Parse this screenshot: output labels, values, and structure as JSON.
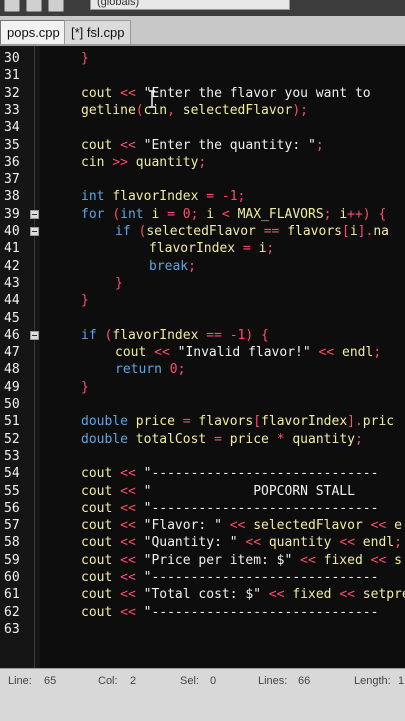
{
  "toolbar": {
    "scope_text": "(globals)"
  },
  "tabs": [
    {
      "label": "pops.cpp"
    },
    {
      "label": "[*] fsl.cpp"
    }
  ],
  "code_lines": [
    {
      "num": "30",
      "fold": false,
      "indent": 0,
      "tokens": [
        [
          "op",
          "}"
        ]
      ]
    },
    {
      "num": "31",
      "fold": false,
      "indent": 0,
      "tokens": []
    },
    {
      "num": "32",
      "fold": false,
      "indent": 0,
      "tokens": [
        [
          "id",
          "cout "
        ],
        [
          "op",
          "<< "
        ],
        [
          "str",
          "\"Enter the flavor you want to"
        ]
      ]
    },
    {
      "num": "33",
      "fold": false,
      "indent": 0,
      "tokens": [
        [
          "id",
          "getline"
        ],
        [
          "op",
          "("
        ],
        [
          "id",
          "cin"
        ],
        [
          "op",
          ", "
        ],
        [
          "id",
          "selectedFlavor"
        ],
        [
          "op",
          ");"
        ]
      ]
    },
    {
      "num": "34",
      "fold": false,
      "indent": 0,
      "tokens": []
    },
    {
      "num": "35",
      "fold": false,
      "indent": 0,
      "tokens": [
        [
          "id",
          "cout "
        ],
        [
          "op",
          "<< "
        ],
        [
          "str",
          "\"Enter the quantity: \""
        ],
        [
          "op",
          ";"
        ]
      ]
    },
    {
      "num": "36",
      "fold": false,
      "indent": 0,
      "tokens": [
        [
          "id",
          "cin "
        ],
        [
          "op",
          ">> "
        ],
        [
          "id",
          "quantity"
        ],
        [
          "op",
          ";"
        ]
      ]
    },
    {
      "num": "37",
      "fold": false,
      "indent": 0,
      "tokens": []
    },
    {
      "num": "38",
      "fold": false,
      "indent": 0,
      "tokens": [
        [
          "kw",
          "int "
        ],
        [
          "id",
          "flavorIndex "
        ],
        [
          "op",
          "= -"
        ],
        [
          "num",
          "1"
        ],
        [
          "op",
          ";"
        ]
      ]
    },
    {
      "num": "39",
      "fold": true,
      "indent": 0,
      "tokens": [
        [
          "kw",
          "for "
        ],
        [
          "op",
          "("
        ],
        [
          "kw",
          "int "
        ],
        [
          "id",
          "i "
        ],
        [
          "op",
          "= "
        ],
        [
          "num",
          "0"
        ],
        [
          "op",
          "; "
        ],
        [
          "id",
          "i "
        ],
        [
          "op",
          "< "
        ],
        [
          "id",
          "MAX_FLAVORS"
        ],
        [
          "op",
          "; "
        ],
        [
          "id",
          "i"
        ],
        [
          "op",
          "++) {"
        ]
      ]
    },
    {
      "num": "40",
      "fold": true,
      "indent": 1,
      "tokens": [
        [
          "kw",
          "if "
        ],
        [
          "op",
          "("
        ],
        [
          "id",
          "selectedFlavor "
        ],
        [
          "op",
          "== "
        ],
        [
          "id",
          "flavors"
        ],
        [
          "op",
          "["
        ],
        [
          "id",
          "i"
        ],
        [
          "op",
          "]."
        ],
        [
          "id",
          "na"
        ]
      ]
    },
    {
      "num": "41",
      "fold": false,
      "indent": 2,
      "tokens": [
        [
          "id",
          "flavorIndex "
        ],
        [
          "op",
          "= "
        ],
        [
          "id",
          "i"
        ],
        [
          "op",
          ";"
        ]
      ]
    },
    {
      "num": "42",
      "fold": false,
      "indent": 2,
      "tokens": [
        [
          "kw",
          "break"
        ],
        [
          "op",
          ";"
        ]
      ]
    },
    {
      "num": "43",
      "fold": false,
      "indent": 1,
      "tokens": [
        [
          "op",
          "}"
        ]
      ]
    },
    {
      "num": "44",
      "fold": false,
      "indent": 0,
      "tokens": [
        [
          "op",
          "}"
        ]
      ]
    },
    {
      "num": "45",
      "fold": false,
      "indent": 0,
      "tokens": []
    },
    {
      "num": "46",
      "fold": true,
      "indent": 0,
      "tokens": [
        [
          "kw",
          "if "
        ],
        [
          "op",
          "("
        ],
        [
          "id",
          "flavorIndex "
        ],
        [
          "op",
          "== -"
        ],
        [
          "num",
          "1"
        ],
        [
          "op",
          ") {"
        ]
      ]
    },
    {
      "num": "47",
      "fold": false,
      "indent": 1,
      "tokens": [
        [
          "id",
          "cout "
        ],
        [
          "op",
          "<< "
        ],
        [
          "str",
          "\"Invalid flavor!\" "
        ],
        [
          "op",
          "<< "
        ],
        [
          "id",
          "endl"
        ],
        [
          "op",
          ";"
        ]
      ]
    },
    {
      "num": "48",
      "fold": false,
      "indent": 1,
      "tokens": [
        [
          "kw",
          "return "
        ],
        [
          "num",
          "0"
        ],
        [
          "op",
          ";"
        ]
      ]
    },
    {
      "num": "49",
      "fold": false,
      "indent": 0,
      "tokens": [
        [
          "op",
          "}"
        ]
      ]
    },
    {
      "num": "50",
      "fold": false,
      "indent": 0,
      "tokens": []
    },
    {
      "num": "51",
      "fold": false,
      "indent": 0,
      "tokens": [
        [
          "kw",
          "double "
        ],
        [
          "id",
          "price "
        ],
        [
          "op",
          "= "
        ],
        [
          "id",
          "flavors"
        ],
        [
          "op",
          "["
        ],
        [
          "id",
          "flavorIndex"
        ],
        [
          "op",
          "]."
        ],
        [
          "id",
          "pric"
        ]
      ]
    },
    {
      "num": "52",
      "fold": false,
      "indent": 0,
      "tokens": [
        [
          "kw",
          "double "
        ],
        [
          "id",
          "totalCost "
        ],
        [
          "op",
          "= "
        ],
        [
          "id",
          "price "
        ],
        [
          "op",
          "* "
        ],
        [
          "id",
          "quantity"
        ],
        [
          "op",
          ";"
        ]
      ]
    },
    {
      "num": "53",
      "fold": false,
      "indent": 0,
      "tokens": []
    },
    {
      "num": "54",
      "fold": false,
      "indent": 0,
      "tokens": [
        [
          "id",
          "cout "
        ],
        [
          "op",
          "<< "
        ],
        [
          "str",
          "\"-----------------------------"
        ]
      ]
    },
    {
      "num": "55",
      "fold": false,
      "indent": 0,
      "tokens": [
        [
          "id",
          "cout "
        ],
        [
          "op",
          "<< "
        ],
        [
          "str",
          "\"             POPCORN STALL"
        ]
      ]
    },
    {
      "num": "56",
      "fold": false,
      "indent": 0,
      "tokens": [
        [
          "id",
          "cout "
        ],
        [
          "op",
          "<< "
        ],
        [
          "str",
          "\"-----------------------------"
        ]
      ]
    },
    {
      "num": "57",
      "fold": false,
      "indent": 0,
      "tokens": [
        [
          "id",
          "cout "
        ],
        [
          "op",
          "<< "
        ],
        [
          "str",
          "\"Flavor: \" "
        ],
        [
          "op",
          "<< "
        ],
        [
          "id",
          "selectedFlavor "
        ],
        [
          "op",
          "<< "
        ],
        [
          "id",
          "e"
        ]
      ]
    },
    {
      "num": "58",
      "fold": false,
      "indent": 0,
      "tokens": [
        [
          "id",
          "cout "
        ],
        [
          "op",
          "<< "
        ],
        [
          "str",
          "\"Quantity: \" "
        ],
        [
          "op",
          "<< "
        ],
        [
          "id",
          "quantity "
        ],
        [
          "op",
          "<< "
        ],
        [
          "id",
          "endl"
        ],
        [
          "op",
          ";"
        ]
      ]
    },
    {
      "num": "59",
      "fold": false,
      "indent": 0,
      "tokens": [
        [
          "id",
          "cout "
        ],
        [
          "op",
          "<< "
        ],
        [
          "str",
          "\"Price per item: $\" "
        ],
        [
          "op",
          "<< "
        ],
        [
          "id",
          "fixed "
        ],
        [
          "op",
          "<< "
        ],
        [
          "id",
          "s"
        ]
      ]
    },
    {
      "num": "60",
      "fold": false,
      "indent": 0,
      "tokens": [
        [
          "id",
          "cout "
        ],
        [
          "op",
          "<< "
        ],
        [
          "str",
          "\"-----------------------------"
        ]
      ]
    },
    {
      "num": "61",
      "fold": false,
      "indent": 0,
      "tokens": [
        [
          "id",
          "cout "
        ],
        [
          "op",
          "<< "
        ],
        [
          "str",
          "\"Total cost: $\" "
        ],
        [
          "op",
          "<< "
        ],
        [
          "id",
          "fixed "
        ],
        [
          "op",
          "<< "
        ],
        [
          "id",
          "setpre"
        ]
      ]
    },
    {
      "num": "62",
      "fold": false,
      "indent": 0,
      "tokens": [
        [
          "id",
          "cout "
        ],
        [
          "op",
          "<< "
        ],
        [
          "str",
          "\"-----------------------------"
        ]
      ]
    },
    {
      "num": "63",
      "fold": false,
      "indent": 0,
      "tokens": []
    }
  ],
  "status": {
    "line_label": "Line:",
    "line_value": "65",
    "col_label": "Col:",
    "col_value": "2",
    "sel_label": "Sel:",
    "sel_value": "0",
    "lines_label": "Lines:",
    "lines_value": "66",
    "length_label": "Length:",
    "length_value": "1"
  }
}
